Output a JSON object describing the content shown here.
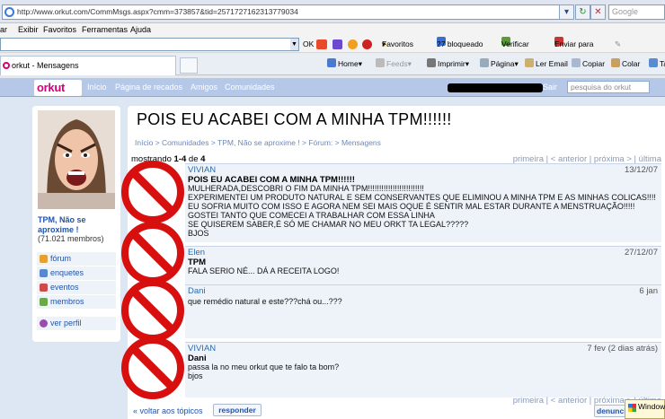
{
  "browser": {
    "url": "http://www.orkut.com/CommMsgs.aspx?cmm=373857&tid=2571727162313779034",
    "search_placeholder": "Google",
    "menu": [
      "ar",
      "Exibir",
      "Favoritos",
      "Ferramentas",
      "Ajuda"
    ],
    "toolbar": {
      "ok": "OK",
      "favoritos": "Favoritos",
      "bloqueado": "27 bloqueado",
      "verificar": "Verificar",
      "enviar": "Enviar para"
    },
    "tab_title": "orkut - Mensagens",
    "commands": [
      "Home",
      "Feeds",
      "Imprimir",
      "Página",
      "Ler Email",
      "Copiar",
      "Colar",
      "Ta"
    ]
  },
  "orkut_nav": {
    "logo": "orkut",
    "links": [
      "Início",
      "Página de recados",
      "Amigos",
      "Comunidades"
    ],
    "sair": "Sair",
    "search_placeholder": "pesquisa do orkut"
  },
  "sidebar": {
    "community_name": "TPM, Não se aproxime !",
    "members": "(71.021 membros)",
    "items": [
      "fórum",
      "enquetes",
      "eventos",
      "membros"
    ],
    "profile_link": "ver perfil"
  },
  "topic": {
    "title": "POIS EU ACABEI COM A MINHA TPM!!!!!!",
    "breadcrumb": [
      "Início",
      "Comunidades",
      "TPM, Não se aproxime !",
      "Fórum:",
      "Mensagens"
    ],
    "showing_prefix": "mostrando",
    "showing_range": "1-4",
    "showing_of": "de",
    "showing_total": "4",
    "pager": [
      "primeira",
      "< anterior",
      "próxima >",
      "última"
    ]
  },
  "posts": [
    {
      "author": "VIVIAN",
      "date": "13/12/07",
      "subject": "POIS EU ACABEI COM A MINHA TPM!!!!!!",
      "body": "MULHERADA,DESCOBRI O FIM DA MINHA TPM!!!!!!!!!!!!!!!!!!!!!!!!!\nEXPERIMENTEI UM PRODUTO NATURAL E SEM CONSERVANTES QUE ELIMINOU A MINHA TPM E AS MINHAS COLICAS!!!!\nEU SOFRIA MUITO COM ISSO E AGORA NEM SEI MAIS OQUE É SENTIR MAL ESTAR DURANTE A MENSTRUAÇÃO!!!!!\nGOSTEI TANTO QUE COMECEI A TRABALHAR COM ESSA LINHA\nSE QUISEREM SABER,É SÓ ME CHAMAR NO MEU ORKT TA LEGAL?????\nBJOS"
    },
    {
      "author": "Elen",
      "date": "27/12/07",
      "subject": "TPM",
      "body": "FALA SERIO NÉ... DÁ A RECEITA LOGO!"
    },
    {
      "author": "Dani",
      "date": "6 jan",
      "subject": "",
      "body": "que remédio natural e este???chá ou...???"
    },
    {
      "author": "VIVIAN",
      "date": "7 fev (2 dias atrás)",
      "subject": "Dani",
      "body": "passa la no meu orkut que te falo ta bom?\nbjos"
    }
  ],
  "footer": {
    "back": "« voltar aos tópicos",
    "reply": "responder",
    "report": "denunciar",
    "windows_popup": "Windows"
  },
  "colors": {
    "orkut_nav_bg": "#b5c8e8",
    "orkut_pink": "#d5007d",
    "page_bg": "#dde6f3",
    "link_blue": "#2153a9",
    "noentry_red": "#d80f0f"
  },
  "icons": [
    "ie-icon",
    "refresh-icon",
    "stop-icon",
    "favorites-star-icon",
    "home-icon",
    "feeds-icon",
    "print-icon",
    "no-entry-icon",
    "windows-flag-icon"
  ]
}
